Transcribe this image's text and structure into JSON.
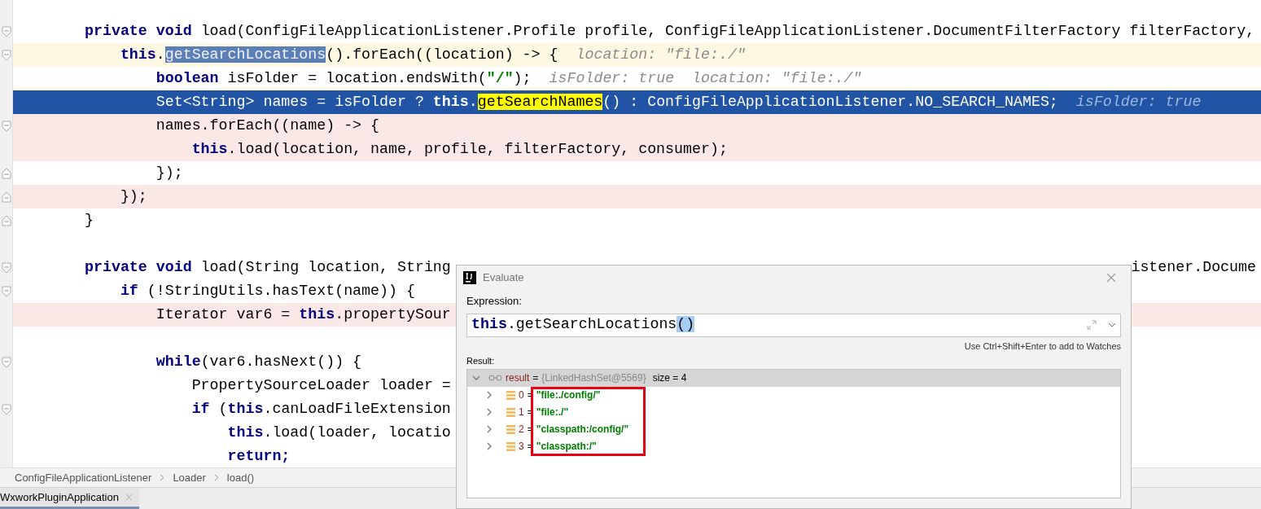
{
  "editor": {
    "lines": [
      {
        "kind": "normal",
        "fold_start": true,
        "code": [
          {
            "kind": "kw",
            "text": "private void"
          },
          {
            "kind": "text",
            "text": " load(ConfigFileApplicationListener.Profile profile, ConfigFileApplicationListener.DocumentFilterFactory filterFactory,"
          }
        ]
      },
      {
        "kind": "current",
        "fold_start": true,
        "code": [
          {
            "kind": "kw",
            "text": "    this"
          },
          {
            "kind": "text",
            "text": "."
          },
          {
            "kind": "sel",
            "text": "getSearchLocations"
          },
          {
            "kind": "text",
            "text": "().forEach((location) -> {"
          }
        ],
        "hint": "location: \"file:./\""
      },
      {
        "kind": "normal",
        "code": [
          {
            "kind": "kw",
            "text": "        boolean"
          },
          {
            "kind": "text",
            "text": " isFolder = location.endsWith("
          },
          {
            "kind": "str",
            "text": "\"/\""
          },
          {
            "kind": "text",
            "text": ");"
          }
        ],
        "hint": "isFolder: true  location: \"file:./\""
      },
      {
        "kind": "exec",
        "code": [
          {
            "kind": "text",
            "text": "        Set<String> names = isFolder ? "
          },
          {
            "kind": "kw",
            "text": "this"
          },
          {
            "kind": "text",
            "text": "."
          },
          {
            "kind": "mark",
            "text": "getSearchNames"
          },
          {
            "kind": "text",
            "text": "() : ConfigFileApplicationListener.NO_SEARCH_NAMES;"
          }
        ],
        "hint": "isFolder: true"
      },
      {
        "kind": "breakpoint",
        "fold_start": true,
        "code": [
          {
            "kind": "text",
            "text": "        names.forEach((name) -> {"
          }
        ]
      },
      {
        "kind": "breakpoint",
        "code": [
          {
            "kind": "kw",
            "text": "            this"
          },
          {
            "kind": "text",
            "text": ".load(location, name, profile, filterFactory, consumer);"
          }
        ]
      },
      {
        "kind": "normal",
        "fold_end": true,
        "code": [
          {
            "kind": "text",
            "text": "        });"
          }
        ]
      },
      {
        "kind": "breakpoint",
        "fold_end": true,
        "code": [
          {
            "kind": "text",
            "text": "    });"
          }
        ]
      },
      {
        "kind": "normal",
        "fold_end": true,
        "code": [
          {
            "kind": "text",
            "text": "}"
          }
        ]
      },
      {
        "kind": "normal"
      },
      {
        "kind": "normal",
        "fold_start": true,
        "code": [
          {
            "kind": "kw",
            "text": "private void"
          },
          {
            "kind": "text",
            "text": " load(String location, String"
          }
        ],
        "tail": "istener.Docume"
      },
      {
        "kind": "normal",
        "fold_start": true,
        "code": [
          {
            "kind": "kw",
            "text": "    if"
          },
          {
            "kind": "text",
            "text": " (!StringUtils.hasText(name)) {"
          }
        ]
      },
      {
        "kind": "breakpoint",
        "code": [
          {
            "kind": "text",
            "text": "        Iterator var6 = "
          },
          {
            "kind": "kw",
            "text": "this"
          },
          {
            "kind": "text",
            "text": ".propertySour"
          }
        ]
      },
      {
        "kind": "normal"
      },
      {
        "kind": "normal",
        "fold_start": true,
        "code": [
          {
            "kind": "kw",
            "text": "        while"
          },
          {
            "kind": "text",
            "text": "(var6.hasNext()) {"
          }
        ]
      },
      {
        "kind": "normal",
        "code": [
          {
            "kind": "text",
            "text": "            PropertySourceLoader loader ="
          }
        ]
      },
      {
        "kind": "normal",
        "fold_start": true,
        "code": [
          {
            "kind": "kw",
            "text": "            if"
          },
          {
            "kind": "text",
            "text": " ("
          },
          {
            "kind": "kw",
            "text": "this"
          },
          {
            "kind": "text",
            "text": ".canLoadFileExtension"
          }
        ]
      },
      {
        "kind": "normal",
        "code": [
          {
            "kind": "kw",
            "text": "                this"
          },
          {
            "kind": "text",
            "text": ".load(loader, locatio"
          }
        ]
      },
      {
        "kind": "normal",
        "code": [
          {
            "kind": "kw",
            "text": "                return;"
          }
        ]
      }
    ]
  },
  "breadcrumbs": [
    "ConfigFileApplicationListener",
    "Loader",
    "load()"
  ],
  "tabs": [
    {
      "label": "WxworkPluginApplication",
      "selected": true
    }
  ],
  "dialog": {
    "title": "Evaluate",
    "expression_label": "Expression:",
    "expression": [
      {
        "kind": "kw",
        "text": "this"
      },
      {
        "kind": "text",
        "text": ".getSearchLocations"
      },
      {
        "kind": "paren",
        "text": "()"
      }
    ],
    "hint": "Use Ctrl+Shift+Enter to add to Watches",
    "result_label": "Result:",
    "result": {
      "name": "result",
      "eq": "=",
      "type": "{LinkedHashSet@5569}",
      "size": "size = 4",
      "expanded": true,
      "selected": true,
      "children": [
        {
          "name": "0",
          "eq": "=",
          "value": "\"file:./config/\"",
          "expanded": false
        },
        {
          "name": "1",
          "eq": "=",
          "value": "\"file:./\"",
          "expanded": false
        },
        {
          "name": "2",
          "eq": "=",
          "value": "\"classpath:/config/\"",
          "expanded": false
        },
        {
          "name": "3",
          "eq": "=",
          "value": "\"classpath:/\"",
          "expanded": false
        }
      ]
    }
  }
}
